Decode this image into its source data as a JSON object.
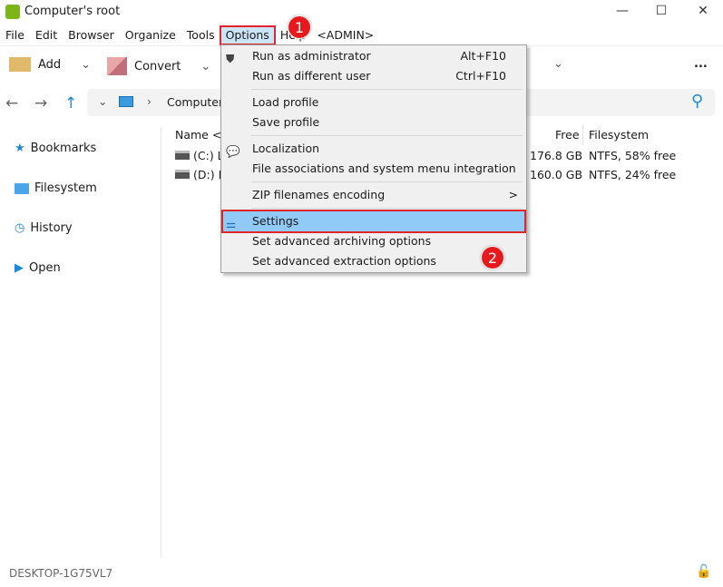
{
  "window": {
    "title": "Computer's root"
  },
  "menubar": [
    "File",
    "Edit",
    "Browser",
    "Organize",
    "Tools",
    "Options",
    "Help",
    "<ADMIN>"
  ],
  "toolbar": {
    "add": "Add",
    "convert": "Convert",
    "more": "..."
  },
  "address": {
    "path": "Computer"
  },
  "sidebar": [
    {
      "label": "Bookmarks",
      "icon": "star-icon"
    },
    {
      "label": "Filesystem",
      "icon": "folder-icon"
    },
    {
      "label": "History",
      "icon": "clock-icon"
    },
    {
      "label": "Open",
      "icon": "play-icon"
    }
  ],
  "columns": {
    "name": "Name <",
    "free": "Free",
    "filesystem": "Filesystem"
  },
  "drives": [
    {
      "name": "(C:) L",
      "free": "176.8 GB",
      "fs": "NTFS, 58% free"
    },
    {
      "name": "(D:) L",
      "free": "160.0 GB",
      "fs": "NTFS, 24% free"
    }
  ],
  "options_menu": {
    "items": [
      {
        "label": "Run as administrator",
        "shortcut": "Alt+F10"
      },
      {
        "label": "Run as different user",
        "shortcut": "Ctrl+F10"
      },
      {
        "label": "Load profile"
      },
      {
        "label": "Save profile"
      },
      {
        "label": "Localization"
      },
      {
        "label": "File associations and system menu integration"
      },
      {
        "label": "ZIP filenames encoding",
        "submenu": ">"
      },
      {
        "label": "Settings"
      },
      {
        "label": "Set advanced archiving options"
      },
      {
        "label": "Set advanced extraction options"
      }
    ]
  },
  "annotations": [
    "1",
    "2"
  ],
  "status": {
    "computer": "DESKTOP-1G75VL7"
  },
  "colors": {
    "highlight": "#91c9f7",
    "annotation": "#e8191d",
    "accent": "#1a8ad8"
  }
}
